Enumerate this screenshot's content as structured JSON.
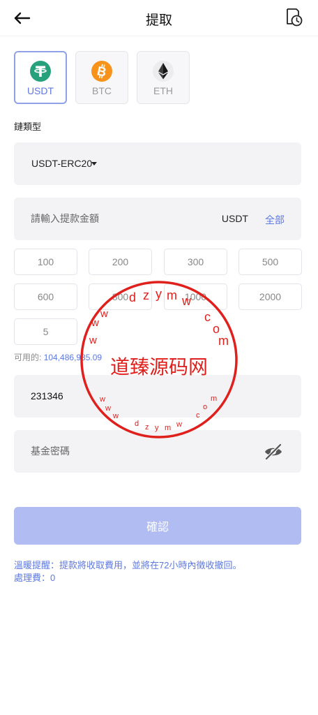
{
  "header": {
    "title": "提取",
    "back_icon": "arrow-left-icon",
    "history_icon": "clock-history-icon"
  },
  "coins": [
    {
      "label": "USDT",
      "icon": "tether-icon",
      "color": "#26a17b",
      "selected": true
    },
    {
      "label": "BTC",
      "icon": "bitcoin-icon",
      "color": "#f7931a",
      "selected": false
    },
    {
      "label": "ETH",
      "icon": "ethereum-icon",
      "color": "#3c3c3d",
      "selected": false
    }
  ],
  "chain": {
    "label": "鏈類型",
    "selected": "USDT-ERC20"
  },
  "amount": {
    "placeholder": "請輸入提款金額",
    "unit": "USDT",
    "all_label": "全部"
  },
  "quick_amounts": [
    "100",
    "200",
    "300",
    "500",
    "600",
    "800",
    "1000",
    "2000",
    "5"
  ],
  "available": {
    "label": "可用的:",
    "value": "104,486,935.09"
  },
  "code": {
    "value": "231346"
  },
  "fund_password": {
    "placeholder": "基金密碼",
    "icon": "eye-off-icon"
  },
  "confirm_label": "確認",
  "notice": {
    "line1": "溫暖提醒：提款將收取費用，並將在72小時內徵收撤回。",
    "line2": "處理費：0"
  },
  "watermark": {
    "center_text": "道臻源码网",
    "ring_text_top": "www.dzymw.com",
    "ring_text_bottom": "www.dzymw.com",
    "color": "#e0201d"
  },
  "colors": {
    "accent": "#5d79e0",
    "confirm_disabled": "#b1bdf2",
    "field_bg": "#f3f3f5"
  }
}
